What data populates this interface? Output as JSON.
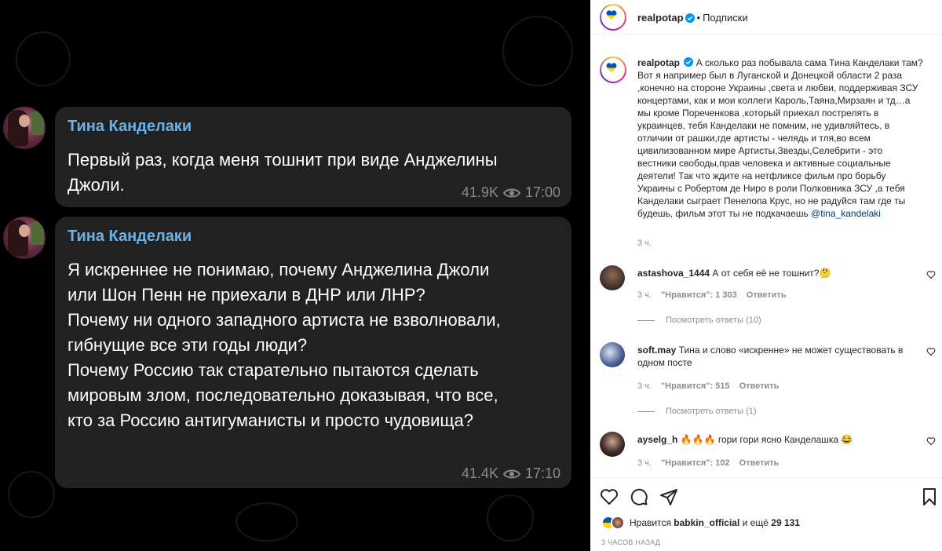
{
  "post_image": {
    "messages": [
      {
        "sender": "Тина Канделаки",
        "lines": [
          "Первый раз, когда меня тошнит при виде Анджелины",
          "Джоли."
        ],
        "views": "41.9K",
        "time": "17:00"
      },
      {
        "sender": "Тина Канделаки",
        "lines": [
          "Я искреннее не понимаю, почему Анджелина Джоли",
          "или Шон Пенн не приехали в ДНР или ЛНР?",
          "Почему ни одного западного артиста не взволновали,",
          "гибнущие все эти годы люди?",
          "Почему Россию так старательно пытаются сделать",
          "мировым злом, последовательно доказывая, что все,",
          "кто за Россию антигуманисты и просто чудовища?"
        ],
        "views": "41.4K",
        "time": "17:10"
      }
    ]
  },
  "header": {
    "username": "realpotap",
    "separator": "•",
    "follow_label": "Подписки"
  },
  "caption": {
    "username": "realpotap",
    "lines": [
      "А сколько раз побывала сама Тина Канделаки там?",
      "Вот я например был в Луганской и Донецкой области 2 раза",
      ",конечно на стороне Украины ,света и любви, поддерживая ЗСУ",
      "концертами, как и мои коллеги Кароль,Таяна,Мирзаян и тд…а",
      "мы кроме Пореченкова ,который приехал пострелять в",
      "украинцев, тебя Канделаки не помним, не удивляйтесь, в",
      "отличии от рашки,где артисты - челядь и тля,во всем",
      "цивилизованном мире Артисты,Звезды,Селебрити - это",
      "вестники свободы,прав человека и активные социальные",
      "деятели! Так что ждите на нетфликсе фильм про борьбу",
      "Украины с Робертом де Ниро в роли Полковника ЗСУ ,а тебя",
      "Канделаки сыграет Пенелопа Крус, но не радуйся там где ты"
    ],
    "last_line": "будешь, фильм этот ты не подкачаешь ",
    "mention": "@tina_kandelaki",
    "time": "3 ч."
  },
  "comments": [
    {
      "username": "astashova_1444",
      "text": "А от себя её не тошнит?🤔",
      "time": "3 ч.",
      "likes": "\"Нравится\": 1 303",
      "reply": "Ответить",
      "view_replies": "Посмотреть ответы (10)"
    },
    {
      "username": "soft.may",
      "text": "Тина и слово «искренне» не может существовать в одном посте",
      "time": "3 ч.",
      "likes": "\"Нравится\": 515",
      "reply": "Ответить",
      "view_replies": "Посмотреть ответы (1)"
    },
    {
      "username": "ayselg_h",
      "text": "🔥🔥🔥 гори гори ясно Канделашка 😂",
      "time": "3 ч.",
      "likes": "\"Нравится\": 102",
      "reply": "Ответить"
    }
  ],
  "footer": {
    "liked_prefix": "Нравится ",
    "liked_user": "babkin_official",
    "liked_suffix": " и ещё ",
    "liked_count": "29 131",
    "posted": "3 ЧАСОВ НАЗАД"
  },
  "colors": {
    "telegram_bubble": "#212121",
    "telegram_sender": "#6cb2e6",
    "link": "#00376b",
    "verified": "#0095f6"
  },
  "icons": [
    "heart-icon",
    "comment-icon",
    "share-icon",
    "bookmark-icon",
    "eye-icon",
    "verified-icon"
  ]
}
